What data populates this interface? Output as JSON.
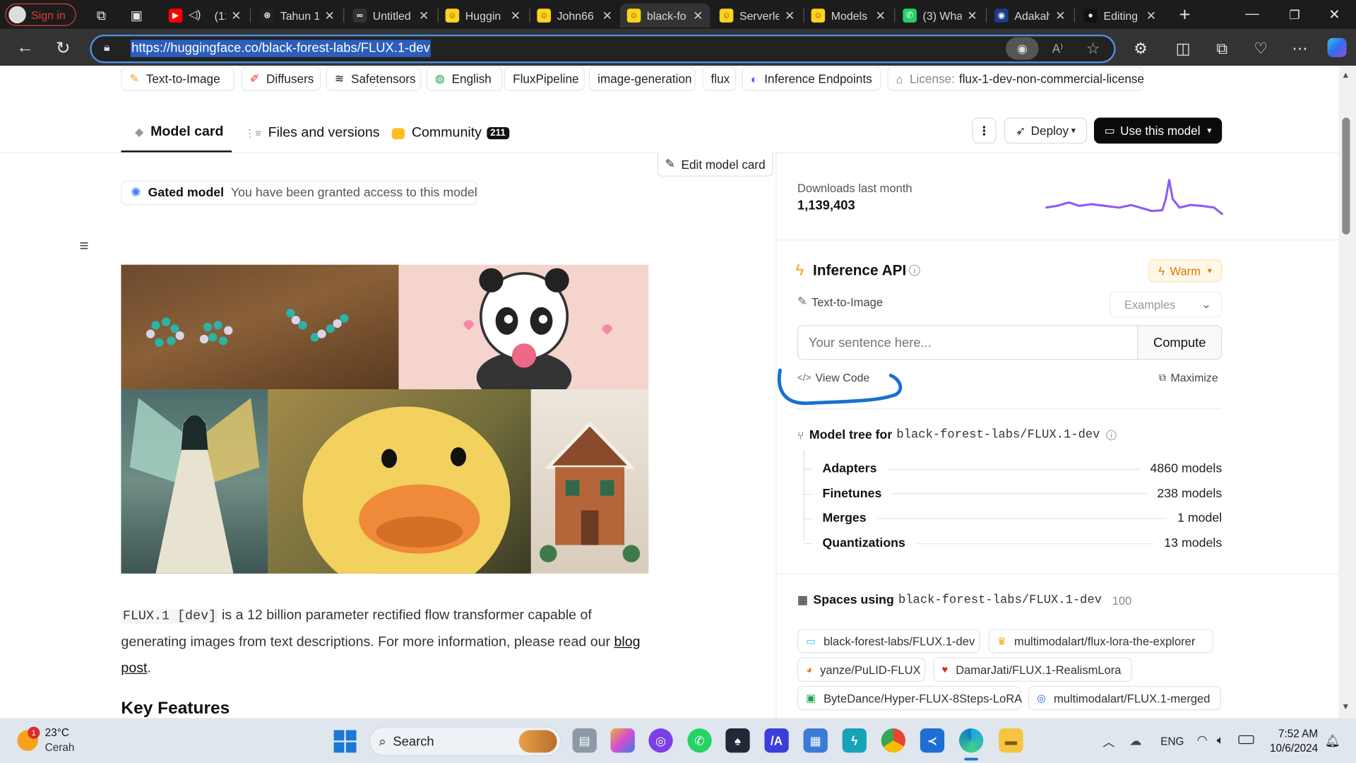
{
  "browser": {
    "profile_label": "Sign in",
    "tabs": [
      {
        "title": "(12",
        "icon": "youtube-icon"
      },
      {
        "title": "Tahun 1",
        "icon": "openai-icon"
      },
      {
        "title": "Untitled",
        "icon": "colab-icon"
      },
      {
        "title": "Huggin",
        "icon": "huggingface-icon"
      },
      {
        "title": "John66",
        "icon": "huggingface-icon"
      },
      {
        "title": "black-fo",
        "icon": "huggingface-icon"
      },
      {
        "title": "Serverle",
        "icon": "huggingface-icon"
      },
      {
        "title": "Models",
        "icon": "huggingface-icon"
      },
      {
        "title": "(3) Wha",
        "icon": "whatsapp-icon"
      },
      {
        "title": "Adakah",
        "icon": "adakah-icon"
      },
      {
        "title": "Editing",
        "icon": "github-icon"
      }
    ],
    "url": "https://huggingface.co/black-forest-labs/FLUX.1-dev"
  },
  "tags": [
    {
      "label": "Text-to-Image",
      "icon": "text-to-image-icon"
    },
    {
      "label": "Diffusers",
      "icon": "diffusers-icon"
    },
    {
      "label": "Safetensors",
      "icon": "safetensors-icon"
    },
    {
      "label": "English",
      "icon": "globe-icon"
    },
    {
      "label": "FluxPipeline",
      "icon": ""
    },
    {
      "label": "image-generation",
      "icon": ""
    },
    {
      "label": "flux",
      "icon": ""
    },
    {
      "label": "Inference Endpoints",
      "icon": "endpoints-icon"
    },
    {
      "license_prefix": "License:",
      "label": "flux-1-dev-non-commercial-license",
      "icon": "license-icon"
    }
  ],
  "model_tabs": {
    "model_card": "Model card",
    "files": "Files and versions",
    "community": "Community",
    "community_count": "211",
    "deploy": "Deploy",
    "use_model": "Use this model"
  },
  "card": {
    "edit_label": "Edit model card",
    "gated_title": "Gated model",
    "gated_text": "You have been granted access to this model",
    "code_name": "FLUX.1 [dev]",
    "description_rest": " is a 12 billion parameter rectified flow transformer capable of generating images from text descriptions. For more information, please read our ",
    "blog_link": "blog post",
    "period": ".",
    "key_features": "Key Features"
  },
  "sidebar": {
    "downloads_label": "Downloads last month",
    "downloads_value": "1,139,403",
    "inference_title": "Inference API",
    "warm_label": "Warm",
    "task_label": "Text-to-Image",
    "examples_label": "Examples",
    "input_placeholder": "Your sentence here...",
    "compute_label": "Compute",
    "view_code": "View Code",
    "maximize": "Maximize",
    "model_tree_prefix": "Model tree for",
    "model_id": "black-forest-labs/FLUX.1-dev",
    "tree": [
      {
        "label": "Adapters",
        "value": "4860 models"
      },
      {
        "label": "Finetunes",
        "value": "238 models"
      },
      {
        "label": "Merges",
        "value": "1 model"
      },
      {
        "label": "Quantizations",
        "value": "13 models"
      }
    ],
    "spaces_prefix": "Spaces using",
    "spaces_count": "100",
    "spaces": [
      "black-forest-labs/FLUX.1-dev",
      "multimodalart/flux-lora-the-explorer",
      "yanze/PuLID-FLUX",
      "DamarJati/FLUX.1-RealismLora",
      "ByteDance/Hyper-FLUX-8Steps-LoRA",
      "multimodalart/FLUX.1-merged"
    ]
  },
  "taskbar": {
    "weather_temp": "23°C",
    "weather_desc": "Cerah",
    "weather_badge": "1",
    "search_label": "Search",
    "lang": "ENG",
    "time": "7:52 AM",
    "date": "10/6/2024"
  },
  "colors": {
    "accent": "#2c5ebc",
    "annotation": "#1a6fd1",
    "sparkline": "#8b5cf6",
    "warm": "#f59e0b"
  }
}
